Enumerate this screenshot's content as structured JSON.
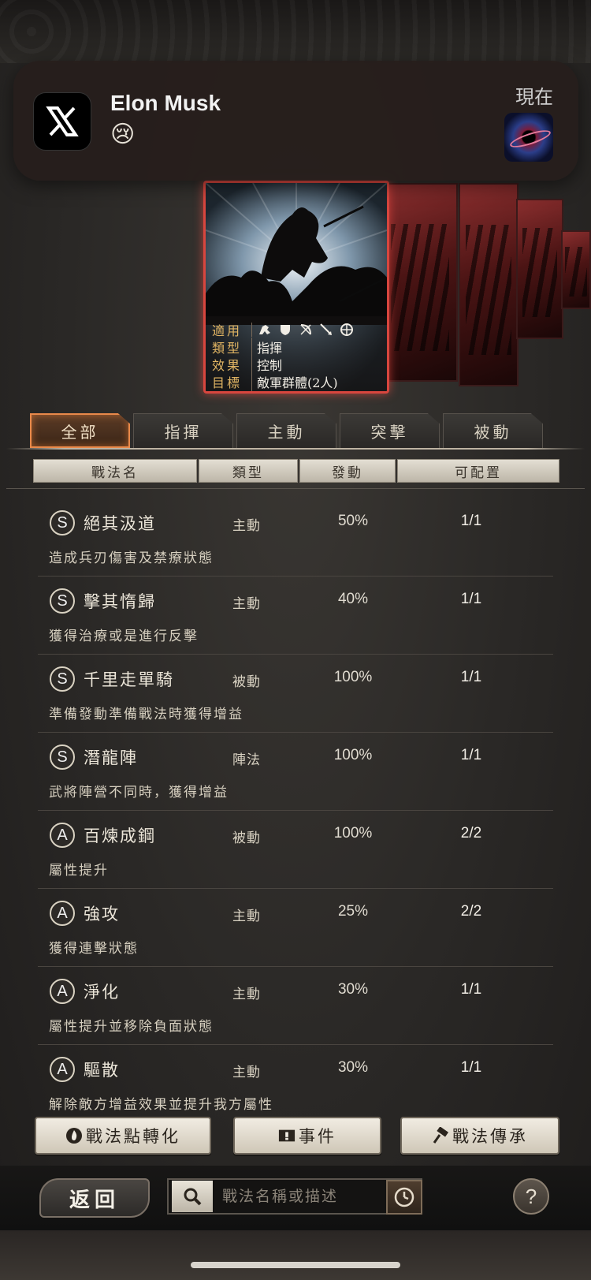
{
  "notification": {
    "app_icon": "x-logo-icon",
    "title": "Elon Musk",
    "body": "😢",
    "time": "現在",
    "thumbnail": "black-hole-thumbnail"
  },
  "card": {
    "rows": [
      {
        "key": "適用",
        "value": ""
      },
      {
        "key": "類型",
        "value": "指揮"
      },
      {
        "key": "效果",
        "value": "控制"
      },
      {
        "key": "目標",
        "value": "敵軍群體(2人)"
      }
    ],
    "unit_icons": [
      "cavalry-icon",
      "shield-icon",
      "bow-icon",
      "spear-icon",
      "siege-icon"
    ]
  },
  "tabs": [
    {
      "label": "全部",
      "active": true
    },
    {
      "label": "指揮",
      "active": false
    },
    {
      "label": "主動",
      "active": false
    },
    {
      "label": "突擊",
      "active": false
    },
    {
      "label": "被動",
      "active": false
    }
  ],
  "columns": {
    "name": "戰法名",
    "type": "類型",
    "rate": "發動",
    "slots": "可配置"
  },
  "skills": [
    {
      "grade": "S",
      "name": "絕其汲道",
      "type": "主動",
      "rate": "50%",
      "slots": "1/1",
      "desc": "造成兵刃傷害及禁療狀態"
    },
    {
      "grade": "S",
      "name": "擊其惰歸",
      "type": "主動",
      "rate": "40%",
      "slots": "1/1",
      "desc": "獲得治療或是進行反擊"
    },
    {
      "grade": "S",
      "name": "千里走單騎",
      "type": "被動",
      "rate": "100%",
      "slots": "1/1",
      "desc": "準備發動準備戰法時獲得增益"
    },
    {
      "grade": "S",
      "name": "潛龍陣",
      "type": "陣法",
      "rate": "100%",
      "slots": "1/1",
      "desc": "武將陣營不同時，獲得增益"
    },
    {
      "grade": "A",
      "name": "百煉成鋼",
      "type": "被動",
      "rate": "100%",
      "slots": "2/2",
      "desc": "屬性提升"
    },
    {
      "grade": "A",
      "name": "強攻",
      "type": "主動",
      "rate": "25%",
      "slots": "2/2",
      "desc": "獲得連擊狀態"
    },
    {
      "grade": "A",
      "name": "淨化",
      "type": "主動",
      "rate": "30%",
      "slots": "1/1",
      "desc": "屬性提升並移除負面狀態"
    },
    {
      "grade": "A",
      "name": "驅散",
      "type": "主動",
      "rate": "30%",
      "slots": "1/1",
      "desc": "解除敵方增益效果並提升我方屬性"
    }
  ],
  "buttons": {
    "convert": "戰法點轉化",
    "events": "事件",
    "inherit": "戰法傳承"
  },
  "footer": {
    "back": "返回",
    "search_placeholder": "戰法名稱或描述",
    "help": "?"
  },
  "colors": {
    "active_tab_border": "#e9894a",
    "card_border": "#d8463e",
    "label_gold": "#e0b463"
  }
}
